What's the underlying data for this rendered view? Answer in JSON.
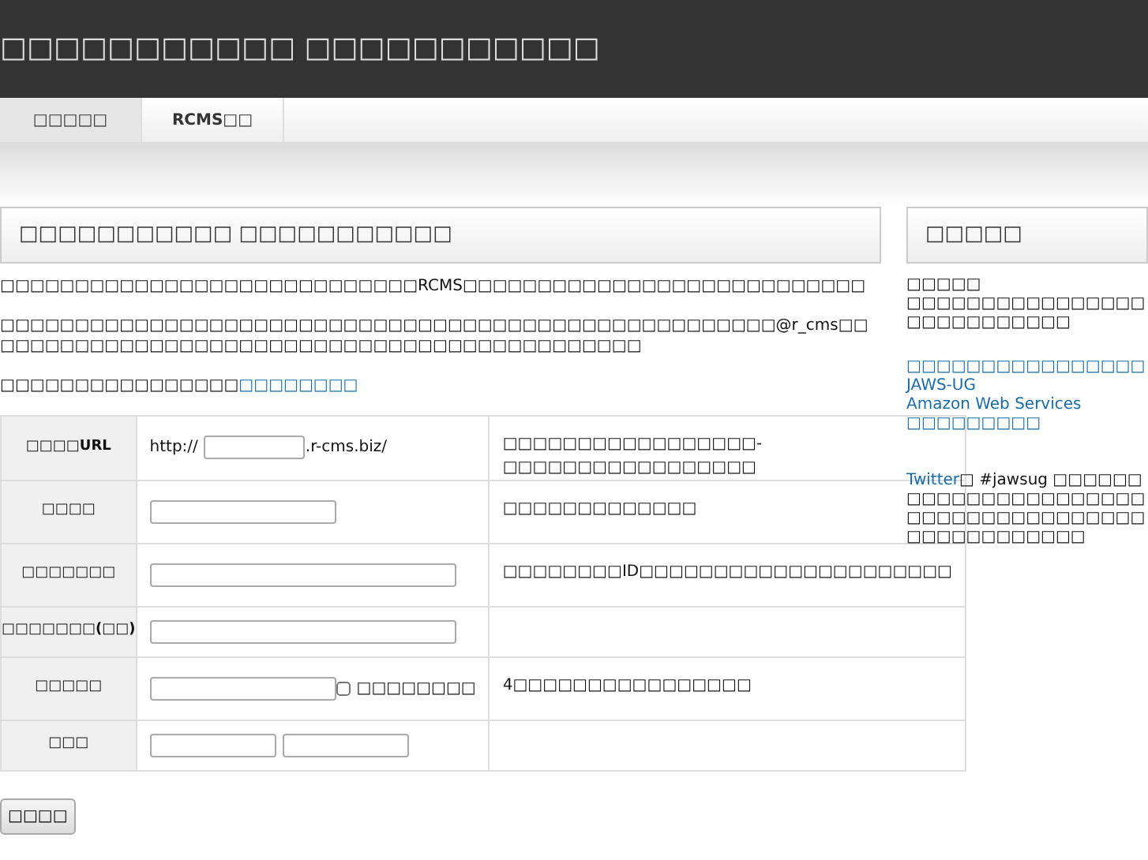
{
  "header": {
    "title": "□□□□□□□□□□□ □□□□□□□□□□□"
  },
  "nav_tabs": [
    {
      "label": "□□□□□",
      "selected": true
    },
    {
      "label": "RCMS□□",
      "selected": false
    }
  ],
  "main": {
    "heading": "□□□□□□□□□□□ □□□□□□□□□□□",
    "paragraphs": [
      [
        {
          "kind": "text",
          "text": "□□□□□□□□□□□□□□□□□□□□□□□□□□□□RCMS□□□□□□□□□□□□□□□□□□□□□□□□□□□"
        }
      ],
      [
        {
          "kind": "text",
          "text": "□□□□□□□□□□□□□□□□□□□□□□□□□□□□□□□□□□□□□□□□□□□□□□□□□□□□@r_cms□□□□□□□□□□□□□□□□□□□□□□□□□□□□□□□□□□□□□□□□□□□□□"
        }
      ],
      [
        {
          "kind": "text",
          "text": "□□□□□□□□□□□□□□□□"
        },
        {
          "kind": "link",
          "text": "□□□□□□□□"
        }
      ]
    ],
    "form_rows": [
      {
        "label": "□□□□URL",
        "kind": "url",
        "prefix": "http://",
        "suffix": ".r-cms.biz/",
        "note": "□□□□□□□□□□□□□□□□□-□□□□□□□□□□□□□□□□□"
      },
      {
        "label": "□□□□",
        "kind": "short",
        "note": "□□□□□□□□□□□□□"
      },
      {
        "label": "□□□□□□□",
        "kind": "long",
        "note": "□□□□□□□□ID□□□□□□□□□□□□□□□□□□□□□"
      },
      {
        "label": "□□□□□□□(□□)",
        "kind": "long"
      },
      {
        "label": "□□□□□",
        "kind": "checkbox",
        "checkbox_label": "□□□□□□□□",
        "checked": false,
        "note": "4□□□□□□□□□□□□□□□□"
      },
      {
        "label": "□□□",
        "kind": "pair"
      }
    ],
    "submit_button": "□□□□"
  },
  "sidebar": {
    "heading": "□□□□□",
    "intro": [
      "□□□□□",
      "□□□□□□□□□□□□□□□□□□□□□□□□□□□"
    ],
    "links": [
      "□□□□□□□□□□□□□□□□",
      "JAWS-UG",
      "Amazon Web Services",
      "□□□□□□□□□"
    ],
    "note": [
      {
        "kind": "link",
        "text": "Twitter"
      },
      {
        "kind": "text",
        "text": "□ #jawsug □□□□□□□□□□□□□□□□□□□□□□□□□□□□□□□□□□□□□□□□□□□□□□□□□□"
      }
    ]
  }
}
